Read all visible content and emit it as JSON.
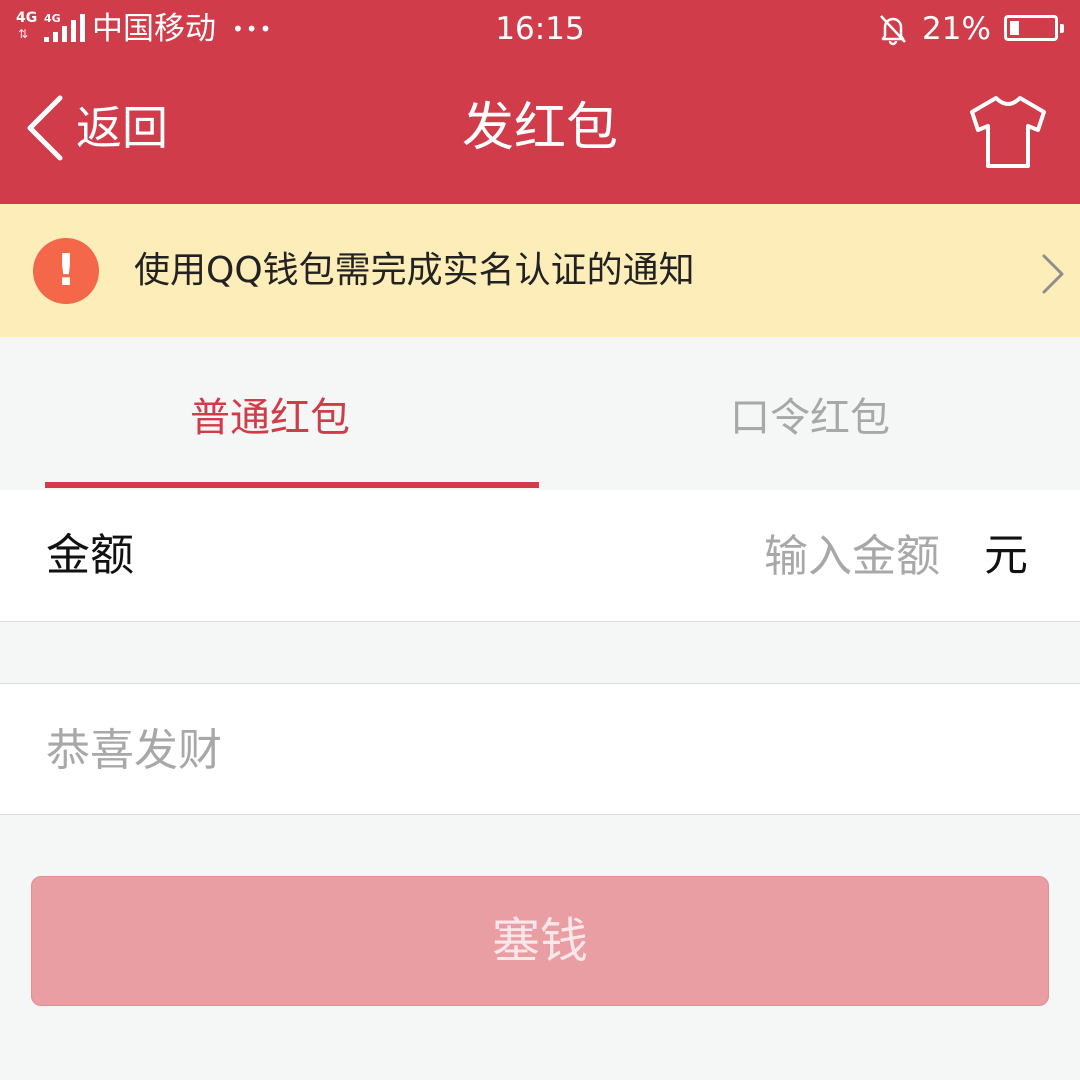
{
  "status_bar": {
    "network_1": "4G",
    "network_2": "4G",
    "carrier": "中国移动",
    "dots": "•••",
    "time": "16:15",
    "battery": "21%",
    "battery_level": 0.21
  },
  "nav": {
    "back_label": "返回",
    "title": "发红包"
  },
  "notice": {
    "icon_glyph": "!",
    "text": "使用QQ钱包需完成实名认证的通知"
  },
  "tabs": {
    "items": [
      {
        "label": "普通红包",
        "active": true
      },
      {
        "label": "口令红包",
        "active": false
      }
    ]
  },
  "amount": {
    "label": "金额",
    "placeholder": "输入金额",
    "unit": "元"
  },
  "greeting": {
    "placeholder": "恭喜发财"
  },
  "submit": {
    "label": "塞钱"
  },
  "colors": {
    "brand_red": "#d03c49",
    "notice_bg": "#fdedb9",
    "notice_icon": "#f46749",
    "button_disabled": "#e99ea4"
  },
  "icons": [
    "signal-icon",
    "bell-muted-icon",
    "battery-icon",
    "back-chevron-icon",
    "tshirt-icon",
    "alert-icon",
    "chevron-right-icon"
  ]
}
